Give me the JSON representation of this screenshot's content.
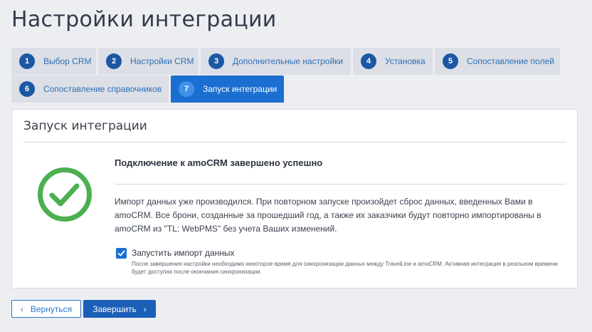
{
  "page": {
    "title": "Настройки интеграции"
  },
  "tabs": [
    {
      "num": "1",
      "label": "Выбор CRM"
    },
    {
      "num": "2",
      "label": "Настройки CRM"
    },
    {
      "num": "3",
      "label": "Дополнительные настройки"
    },
    {
      "num": "4",
      "label": "Установка"
    },
    {
      "num": "5",
      "label": "Сопоставление полей"
    },
    {
      "num": "6",
      "label": "Сопоставление справочников"
    },
    {
      "num": "7",
      "label": "Запуск интеграции",
      "active": true
    }
  ],
  "panel": {
    "title": "Запуск интеграции",
    "success_title": "Подключение к amoCRM завершено успешно",
    "description": "Импорт данных уже производился. При повторном запуске произойдет сброс данных, введенных Вами в amoCRM. Все брони, созданные за прошедший год, а также их заказчики будут повторно импортированы в amoCRM из \"TL: WebPMS\" без учета Ваших изменений.",
    "checkbox": {
      "label": "Запустить импорт данных",
      "checked": true,
      "note": "После завершения настройки необходимо некоторое время для синхронизации данных между TravelLine и amoCRM. Активная интеграция в реальном времени будет доступна после окончания синхронизации."
    }
  },
  "buttons": {
    "back_label": "Вернуться",
    "back_icon": "chevron-left-icon",
    "finish_label": "Завершить",
    "finish_icon": "chevron-right-icon"
  },
  "colors": {
    "accent": "#1b6fd1",
    "success": "#4caf50",
    "tab_bg": "#dcdfe6",
    "page_bg": "#edeef2"
  }
}
